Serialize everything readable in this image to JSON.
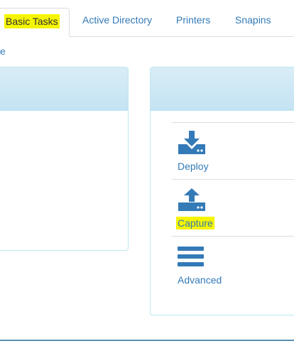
{
  "tabs": [
    {
      "label": "Basic Tasks",
      "active": true
    },
    {
      "label": "Active Directory"
    },
    {
      "label": "Printers"
    },
    {
      "label": "Snapins"
    }
  ],
  "subnav": {
    "fragment": "e"
  },
  "tasks": {
    "items": [
      {
        "label": "Deploy",
        "icon": "download-icon"
      },
      {
        "label": "Capture",
        "icon": "upload-icon",
        "highlighted": true
      },
      {
        "label": "Advanced",
        "icon": "menu-bars-icon"
      }
    ]
  },
  "colors": {
    "link": "#337ab7",
    "highlight": "#f5f500",
    "panel_heading": "#d9edf7",
    "panel_border": "#bce8f1"
  }
}
